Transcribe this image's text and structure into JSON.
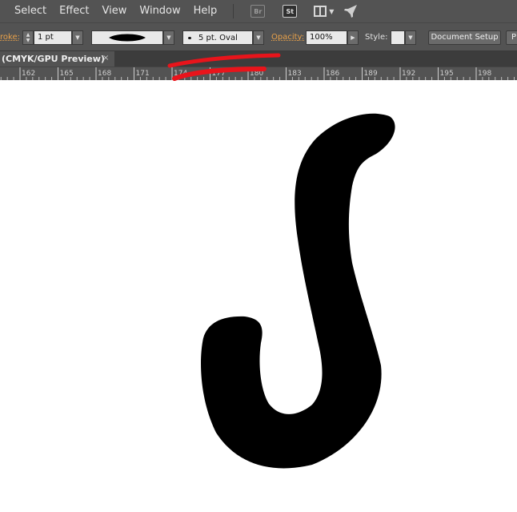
{
  "menubar": {
    "items": [
      "Select",
      "Effect",
      "View",
      "Window",
      "Help"
    ],
    "bridge_icon": "Br",
    "stock_icon": "St"
  },
  "control": {
    "stroke_label": "roke:",
    "stroke_weight": "1 pt",
    "brush_name": "5 pt. Oval",
    "opacity_label": "Opacity:",
    "opacity_value": "100%",
    "style_label": "Style:",
    "document_setup": "Document Setup",
    "preferences_short": "P"
  },
  "document_tab": {
    "label": "(CMYK/GPU Preview)",
    "close": "×"
  },
  "ruler": {
    "labels": [
      "162",
      "165",
      "168",
      "171",
      "174",
      "177",
      "180",
      "183",
      "186",
      "189",
      "192",
      "195",
      "198"
    ]
  },
  "colors": {
    "ui_dark": "#535353",
    "accent_orange": "#e8a14a",
    "annotation_red": "#e8141b",
    "artwork": "#000000"
  }
}
